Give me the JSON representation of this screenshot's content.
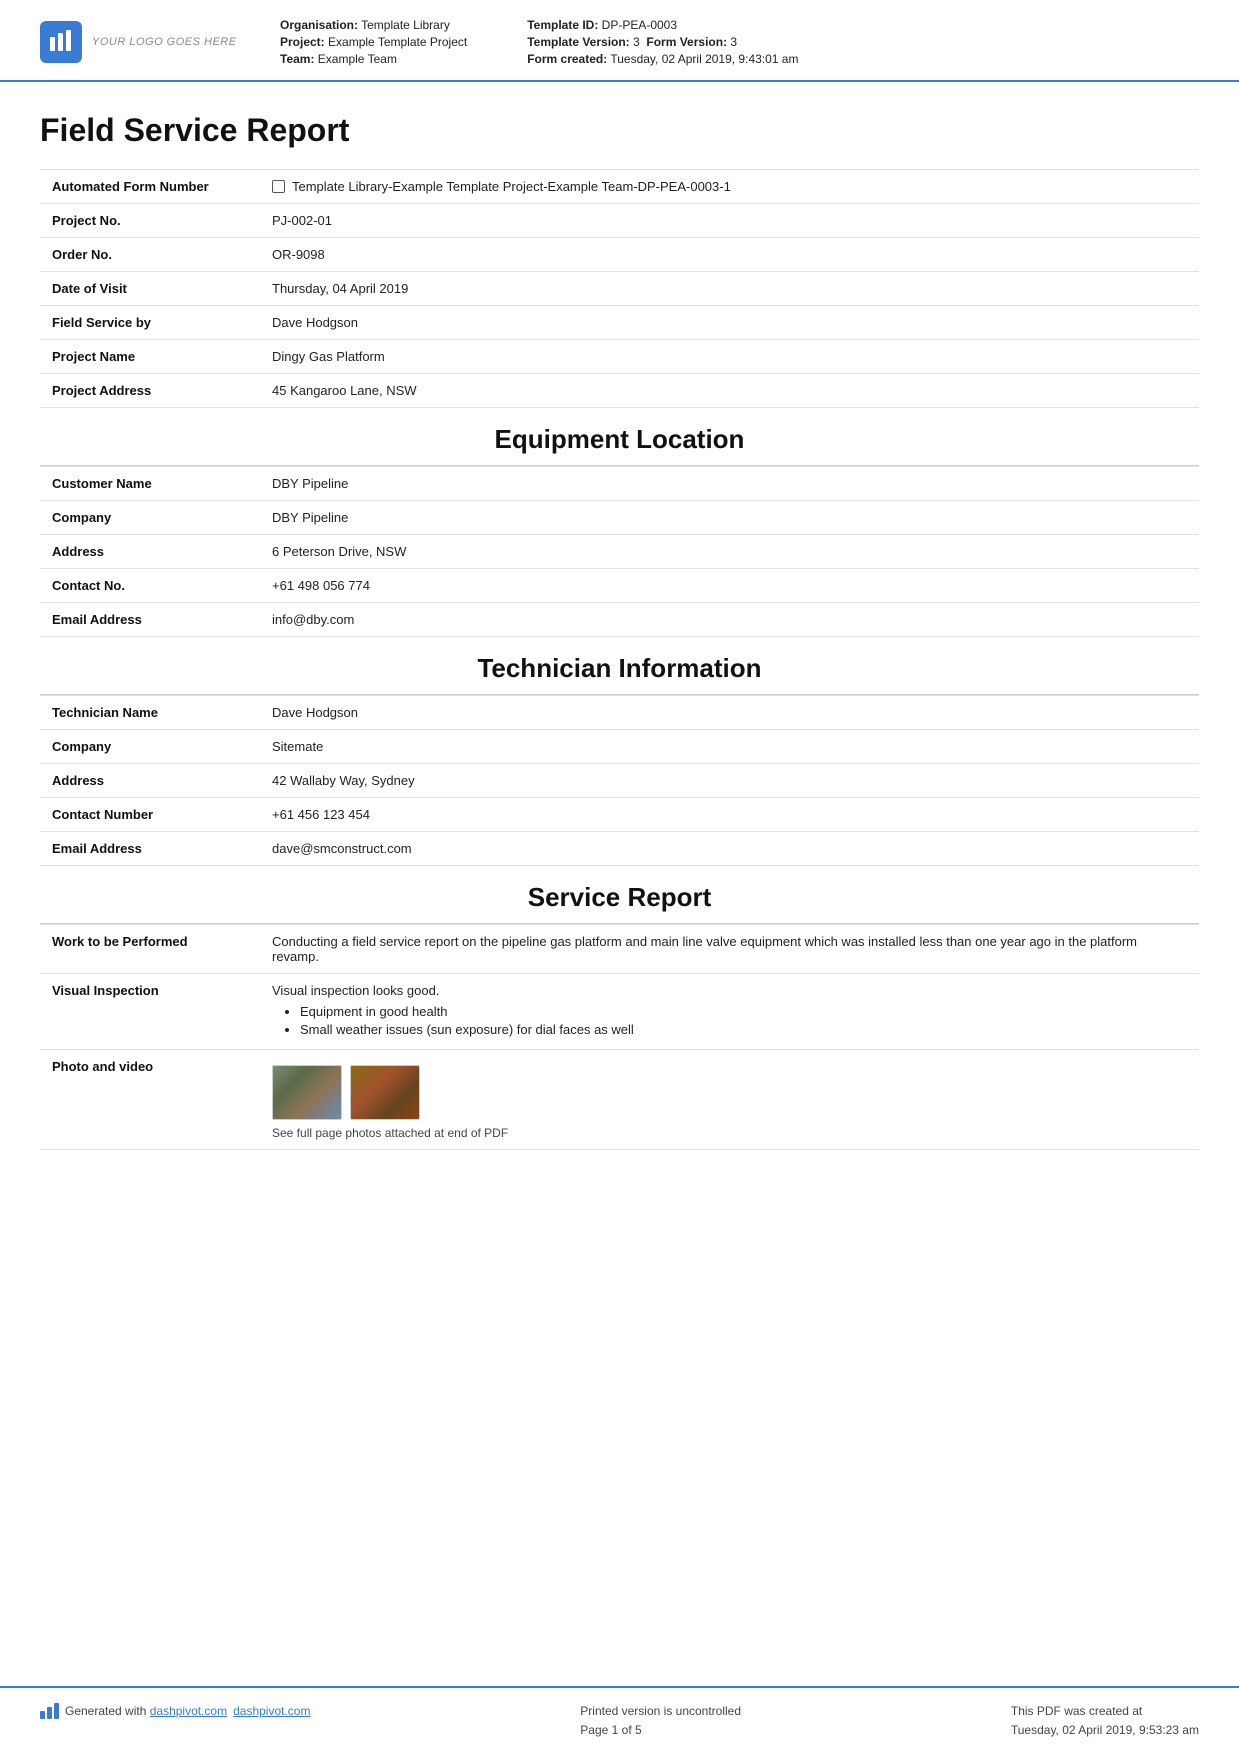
{
  "header": {
    "logo_text": "YOUR LOGO GOES HERE",
    "organisation_label": "Organisation:",
    "organisation_value": "Template Library",
    "project_label": "Project:",
    "project_value": "Example Template Project",
    "team_label": "Team:",
    "team_value": "Example Team",
    "template_id_label": "Template ID:",
    "template_id_value": "DP-PEA-0003",
    "template_version_label": "Template Version:",
    "template_version_value": "3",
    "form_version_label": "Form Version:",
    "form_version_value": "3",
    "form_created_label": "Form created:",
    "form_created_value": "Tuesday, 02 April 2019, 9:43:01 am"
  },
  "page_title": "Field Service Report",
  "form_fields": [
    {
      "label": "Automated Form Number",
      "value": "Template Library-Example Template Project-Example Team-DP-PEA-0003-1",
      "has_checkbox": true
    },
    {
      "label": "Project No.",
      "value": "PJ-002-01"
    },
    {
      "label": "Order No.",
      "value": "OR-9098"
    },
    {
      "label": "Date of Visit",
      "value": "Thursday, 04 April 2019"
    },
    {
      "label": "Field Service by",
      "value": "Dave Hodgson"
    },
    {
      "label": "Project Name",
      "value": "Dingy Gas Platform"
    },
    {
      "label": "Project Address",
      "value": "45 Kangaroo Lane, NSW"
    }
  ],
  "equipment_location": {
    "title": "Equipment Location",
    "fields": [
      {
        "label": "Customer Name",
        "value": "DBY Pipeline"
      },
      {
        "label": "Company",
        "value": "DBY Pipeline"
      },
      {
        "label": "Address",
        "value": "6 Peterson Drive, NSW"
      },
      {
        "label": "Contact No.",
        "value": "+61 498 056 774"
      },
      {
        "label": "Email Address",
        "value": "info@dby.com"
      }
    ]
  },
  "technician_info": {
    "title": "Technician Information",
    "fields": [
      {
        "label": "Technician Name",
        "value": "Dave Hodgson"
      },
      {
        "label": "Company",
        "value": "Sitemate"
      },
      {
        "label": "Address",
        "value": "42 Wallaby Way, Sydney"
      },
      {
        "label": "Contact Number",
        "value": "+61 456 123 454"
      },
      {
        "label": "Email Address",
        "value": "dave@smconstruct.com"
      }
    ]
  },
  "service_report": {
    "title": "Service Report",
    "fields": [
      {
        "label": "Work to be Performed",
        "value": "Conducting a field service report on the pipeline gas platform and main line valve equipment which was installed less than one year ago in the platform revamp."
      },
      {
        "label": "Visual Inspection",
        "value": "Visual inspection looks good.",
        "bullets": [
          "Equipment in good health",
          "Small weather issues (sun exposure) for dial faces as well"
        ]
      },
      {
        "label": "Photo and video",
        "photo_caption": "See full page photos attached at end of PDF"
      }
    ]
  },
  "footer": {
    "generated_text": "Generated with ",
    "link_text": "dashpivot.com",
    "printed_text": "Printed version is uncontrolled",
    "page_text": "Page 1 of 5",
    "pdf_created_text": "This PDF was created at",
    "pdf_created_date": "Tuesday, 02 April 2019, 9:53:23 am"
  }
}
